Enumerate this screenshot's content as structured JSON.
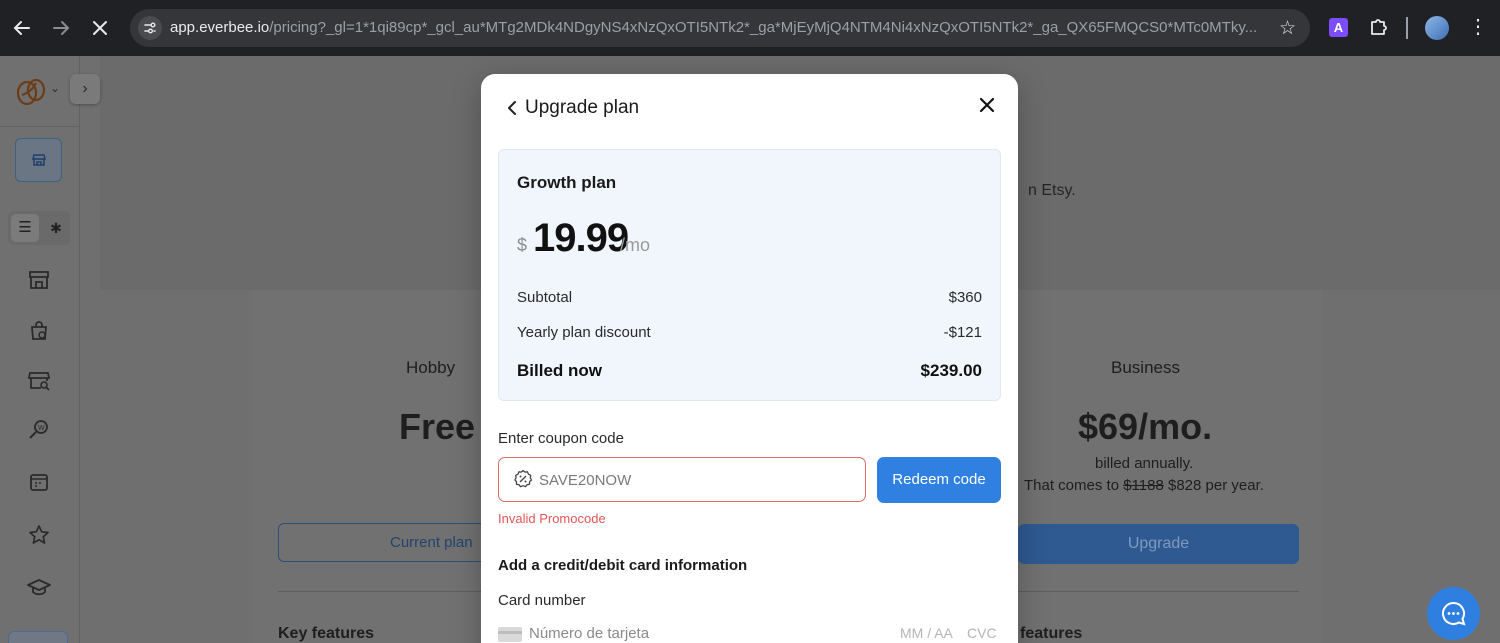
{
  "browser": {
    "url_domain": "app.everbee.io",
    "url_rest": "/pricing?_gl=1*1qi89cp*_gcl_au*MTg2MDk4NDgyNS4xNzQxOTI5NTk2*_ga*MjEyMjQ4NTM4Ni4xNzQxOTI5NTk2*_ga_QX65FMQCS0*MTc0MTky...",
    "back_icon": "arrow-left-icon",
    "forward_icon": "arrow-right-icon",
    "stop_icon": "close-icon",
    "extension_a_label": "A"
  },
  "background": {
    "hero_fragment": "n Etsy.",
    "plans": [
      {
        "name": "Hobby",
        "price": "Free",
        "button": "Current plan"
      },
      {
        "name": "Business",
        "price": "$69/mo.",
        "billing": "billed annually.",
        "comes_to_prefix": "That comes to",
        "comes_to_old": "$1188",
        "comes_to_new": "$828 per year.",
        "button": "Upgrade"
      }
    ],
    "key_features_left": "Key features",
    "key_features_right": "features"
  },
  "modal": {
    "title": "Upgrade plan",
    "plan_name": "Growth plan",
    "currency": "$",
    "price": "19.99",
    "period": "/mo",
    "rows": [
      {
        "label": "Subtotal",
        "value": "$360"
      },
      {
        "label": "Yearly plan discount",
        "value": "-$121"
      },
      {
        "label": "Billed now",
        "value": "$239.00"
      }
    ],
    "coupon_label": "Enter coupon code",
    "coupon_value": "SAVE20NOW",
    "redeem_label": "Redeem code",
    "coupon_error": "Invalid Promocode",
    "card_heading": "Add a credit/debit card information",
    "card_number_label": "Card number",
    "card_number_placeholder": "Número de tarjeta",
    "card_exp_placeholder": "MM / AA",
    "card_cvc_placeholder": "CVC"
  },
  "colors": {
    "accent": "#2f80e0",
    "error": "#e25555",
    "summary_bg": "#f1f6fc"
  }
}
